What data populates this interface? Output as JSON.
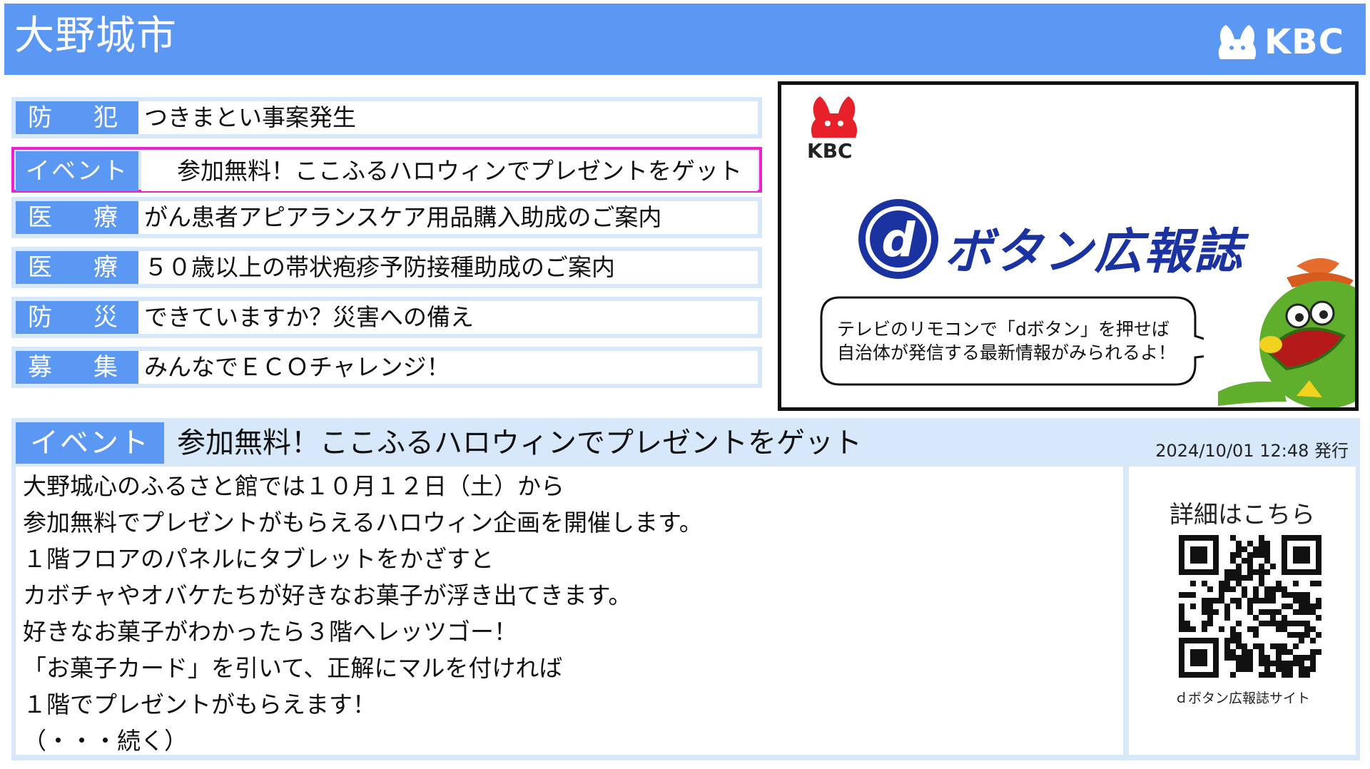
{
  "header": {
    "city": "大野城市",
    "brand": "KBC"
  },
  "news": [
    {
      "category": "防　犯",
      "title": "つきまとい事案発生"
    },
    {
      "category": "イベント",
      "title": "参加無料！ここふるハロウィンでプレゼントをゲット"
    },
    {
      "category": "医　療",
      "title": "がん患者アピアランスケア用品購入助成のご案内"
    },
    {
      "category": "医　療",
      "title": "５０歳以上の帯状疱疹予防接種助成のご案内"
    },
    {
      "category": "防　災",
      "title": "できていますか？災害への備え"
    },
    {
      "category": "募　集",
      "title": "みんなでＥＣＯチャレンジ！"
    }
  ],
  "selected_index": 1,
  "promo": {
    "brand": "KBC",
    "logo_letter": "d",
    "headline": "ボタン広報誌",
    "bubble_lines": [
      "テレビのリモコンで「dボタン」を押せば",
      "自治体が発信する最新情報がみられるよ！"
    ]
  },
  "detail": {
    "category": "イベント",
    "title": "参加無料！ここふるハロウィンでプレゼントをゲット",
    "issued": "2024/10/01 12:48 発行",
    "body_lines": [
      "大野城心のふるさと館では１０月１２日（土）から",
      "参加無料でプレゼントがもらえるハロウィン企画を開催します。",
      "１階フロアのパネルにタブレットをかざすと",
      "カボチャやオバケたちが好きなお菓子が浮き出てきます。",
      "好きなお菓子がわかったら３階へレッツゴー！",
      "「お菓子カード」を引いて、正解にマルを付ければ",
      "１階でプレゼントがもらえます！",
      "（・・・続く）"
    ],
    "more_label": "詳細はこちら",
    "site_label": "ｄボタン広報誌サイト"
  },
  "colors": {
    "header_blue": "#5b98f4",
    "panel_light": "#d8e8fb",
    "selected_border": "#ee22cc",
    "logo_navy": "#1b33a0"
  }
}
